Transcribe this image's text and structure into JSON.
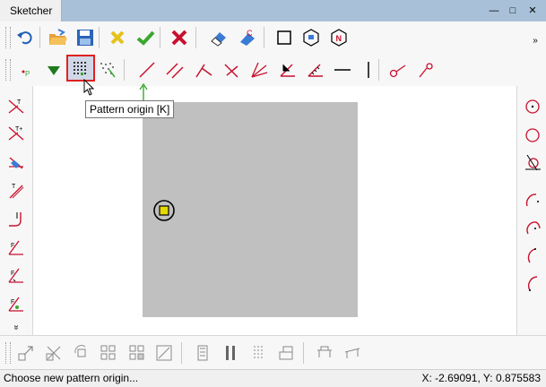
{
  "window": {
    "title": "Sketcher"
  },
  "window_buttons": {
    "minimize": "—",
    "maximize": "□",
    "close": "✕"
  },
  "tooltip": {
    "text": "Pattern origin [K]"
  },
  "status": {
    "message": "Choose new pattern origin...",
    "coords": "X: -2.69091, Y: 0.875583"
  },
  "toolbar_overflow": "»",
  "sidebar_overflow": "»",
  "toolbar1": {
    "icons": [
      "undo-icon",
      "open-folder-icon",
      "save-icon",
      "cancel-yellow-x-icon",
      "accept-checkmark-icon",
      "close-red-x-icon",
      "eraser-icon",
      "clear-eraser-icon",
      "square-outline-icon",
      "hexagon-icon",
      "hexagon-n-icon"
    ]
  },
  "toolbar2": {
    "icons": [
      "point-icon",
      "triangle-down-icon",
      "pattern-origin-grid-icon",
      "pattern-scatter-icon",
      "line-icon",
      "parallel-lines-icon",
      "angle-line-icon",
      "cross-line-icon",
      "fan-lines-icon",
      "corner-line-icon",
      "corner-hatch-icon",
      "horizontal-line-icon",
      "vertical-line-icon",
      "circle-line-icon",
      "arc-line-icon"
    ]
  },
  "colors": {
    "accent_red": "#e02020",
    "sheet_gray": "#c0c0c0",
    "marker_yellow": "#e6d800",
    "icon_red": "#c8102e"
  }
}
